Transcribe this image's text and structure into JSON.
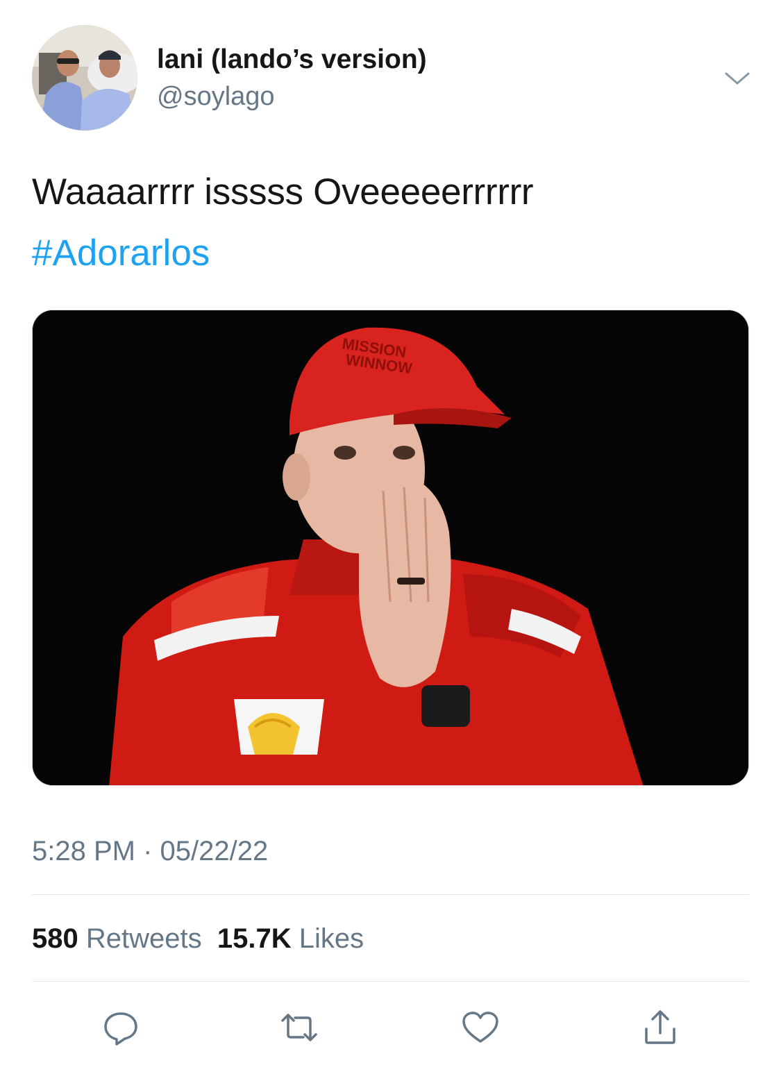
{
  "user": {
    "display_name": "lani (lando’s version)",
    "handle": "@soylago"
  },
  "tweet": {
    "text": "Waaaarrrr isssss Oveeeeerrrrrr",
    "hashtag": "#Adorarlos",
    "time": "5:28 PM",
    "separator": "·",
    "date": "05/22/22"
  },
  "stats": {
    "retweets_count": "580",
    "retweets_label": "Retweets",
    "likes_count": "15.7K",
    "likes_label": "Likes"
  },
  "colors": {
    "link": "#1da1f2",
    "secondary_text": "#657786",
    "primary_text": "#14171a"
  },
  "icons": [
    "chevron-down-icon",
    "reply-icon",
    "retweet-icon",
    "like-icon",
    "share-icon"
  ]
}
